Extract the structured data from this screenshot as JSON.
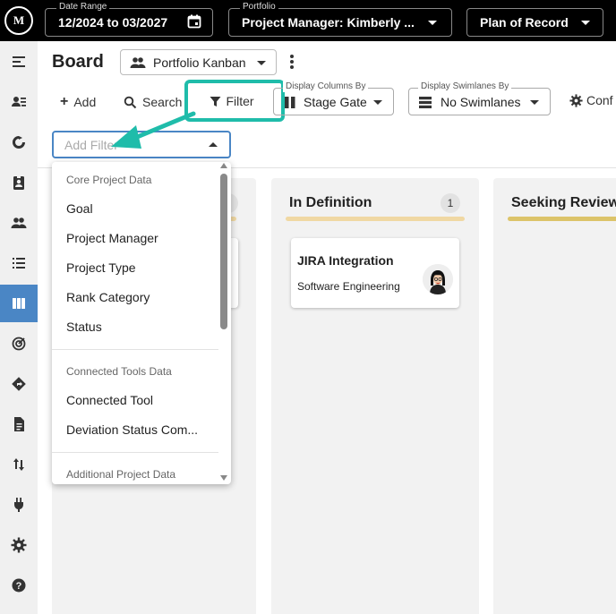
{
  "top_bar": {
    "logo_text": "M",
    "date_range": {
      "label": "Date Range",
      "value": "12/2024 to 03/2027",
      "icon": "calendar-icon"
    },
    "portfolio": {
      "label": "Portfolio",
      "value": "Project Manager: Kimberly ..."
    },
    "plan": {
      "value": "Plan of Record"
    }
  },
  "sidebar": {
    "items": [
      {
        "icon": "menu-icon"
      },
      {
        "icon": "people-list-icon"
      },
      {
        "icon": "cycle-icon"
      },
      {
        "icon": "contact-badge-icon"
      },
      {
        "icon": "group-icon"
      },
      {
        "icon": "list-icon"
      },
      {
        "icon": "board-icon",
        "active": true
      },
      {
        "icon": "target-icon"
      },
      {
        "icon": "directions-icon"
      },
      {
        "icon": "document-icon"
      },
      {
        "icon": "sort-arrows-icon"
      },
      {
        "icon": "plug-icon"
      },
      {
        "icon": "settings-icon"
      },
      {
        "icon": "help-icon"
      }
    ]
  },
  "header": {
    "title": "Board",
    "view_select": "Portfolio Kanban"
  },
  "toolbar": {
    "add_label": "Add",
    "search_label": "Search",
    "filter_label": "Filter",
    "columns": {
      "label": "Display Columns By",
      "value": "Stage Gate"
    },
    "swimlanes": {
      "label": "Display Swimlanes By",
      "value": "No Swimlanes"
    },
    "config_label": "Conf"
  },
  "add_filter": {
    "placeholder": "Add Filter"
  },
  "filter_dropdown": {
    "groups": [
      {
        "label": "Core Project Data",
        "items": [
          "Goal",
          "Project Manager",
          "Project Type",
          "Rank Category",
          "Status"
        ]
      },
      {
        "label": "Connected Tools Data",
        "items": [
          "Connected Tool",
          "Deviation Status Com..."
        ]
      },
      {
        "label": "Additional Project Data",
        "items": []
      }
    ]
  },
  "columns": [
    {
      "title": "In Definition",
      "count": "1",
      "bar_color": "#f0d8a3"
    },
    {
      "title": "Seeking Review",
      "count": "",
      "bar_color": "#dcc46a"
    }
  ],
  "cards": [
    {
      "title": "JIRA Integration",
      "subtitle": "Software Engineering"
    }
  ],
  "colors": {
    "accent": "#4a86c5",
    "highlight": "#1fbcaa"
  }
}
